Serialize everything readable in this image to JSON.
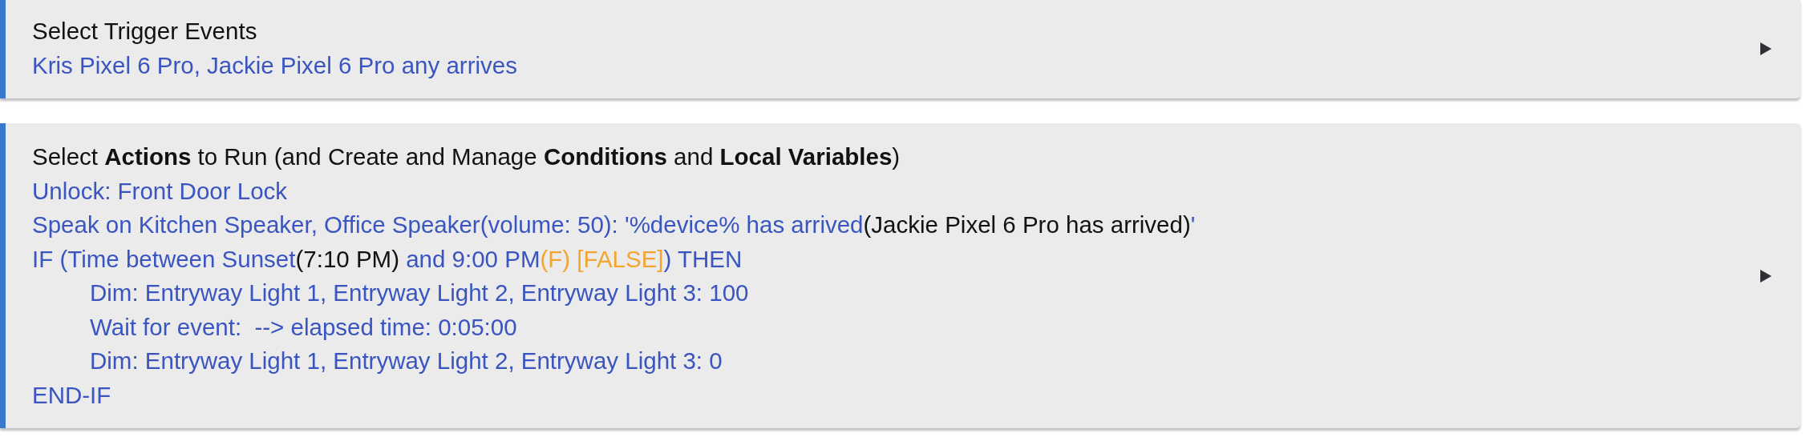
{
  "sections": [
    {
      "title": "Select Trigger Events",
      "expanded": false,
      "lines": [
        {
          "segments": [
            {
              "kind": "link",
              "text": "Kris Pixel 6 Pro, Jackie Pixel 6 Pro any arrives"
            }
          ]
        }
      ]
    },
    {
      "title": "Select **Actions** to Run (and Create and Manage **Conditions** and **Local Variables**)",
      "expanded": false,
      "lines": [
        {
          "segments": [
            {
              "kind": "link",
              "text": "Unlock: Front Door Lock"
            }
          ]
        },
        {
          "segments": [
            {
              "kind": "link",
              "text": "Speak on Kitchen Speaker, Office Speaker(volume: 50): '%device% has arrived"
            },
            {
              "kind": "plain",
              "text": "(Jackie Pixel 6 Pro has arrived)"
            },
            {
              "kind": "link",
              "text": "'"
            }
          ]
        },
        {
          "segments": [
            {
              "kind": "link",
              "text": "IF (Time between Sunset"
            },
            {
              "kind": "plain",
              "text": "(7:10 PM)"
            },
            {
              "kind": "link",
              "text": " and 9:00 PM"
            },
            {
              "kind": "warning",
              "text": "(F) [FALSE]"
            },
            {
              "kind": "link",
              "text": ") THEN"
            }
          ],
          "children": [
            {
              "segments": [
                {
                  "kind": "link",
                  "text": "Dim: Entryway Light 1, Entryway Light 2, Entryway Light 3: 100"
                }
              ]
            },
            {
              "segments": [
                {
                  "kind": "link",
                  "text": "Wait for event:  --> elapsed time: 0:05:00"
                }
              ]
            },
            {
              "segments": [
                {
                  "kind": "link",
                  "text": "Dim: Entryway Light 1, Entryway Light 2, Entryway Light 3: 0"
                }
              ]
            }
          ]
        },
        {
          "segments": [
            {
              "kind": "link",
              "text": "END-IF"
            }
          ]
        }
      ]
    }
  ]
}
